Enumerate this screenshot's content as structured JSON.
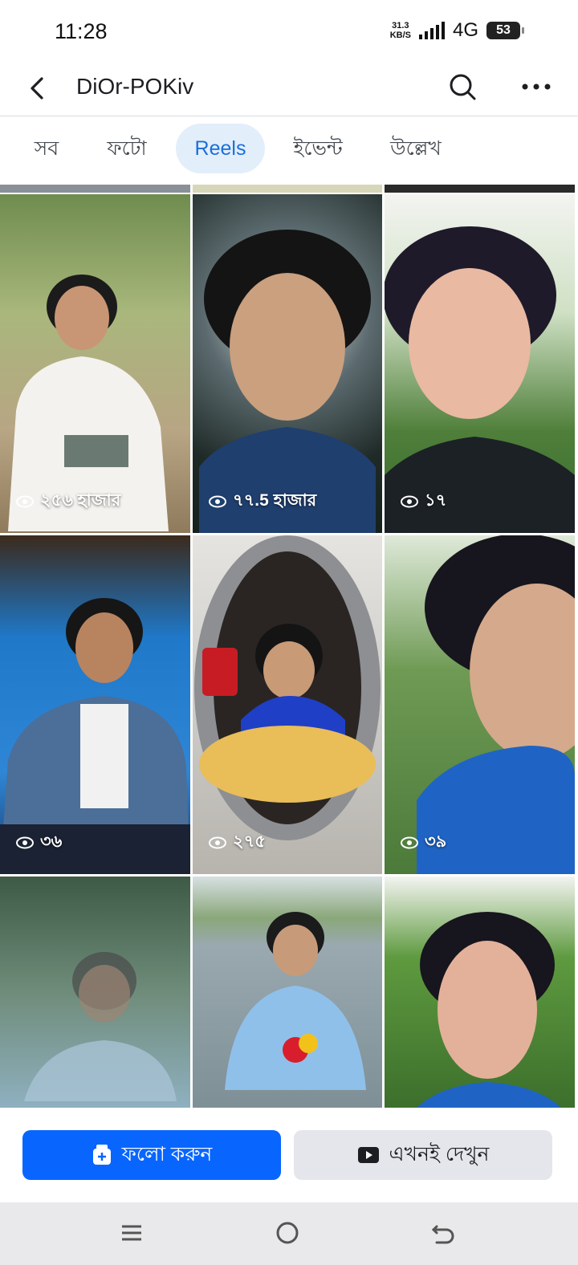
{
  "status": {
    "time": "11:28",
    "net_speed_value": "31.3",
    "net_speed_unit": "KB/S",
    "network": "4G",
    "battery": "53"
  },
  "header": {
    "title": "DiOr-POKiv",
    "back_icon": "back-arrow-icon",
    "search_icon": "search-icon",
    "more_icon": "more-horizontal-icon"
  },
  "tabs": [
    {
      "label": "সব",
      "active": false
    },
    {
      "label": "ফটো",
      "active": false
    },
    {
      "label": "Reels",
      "active": true
    },
    {
      "label": "ইভেন্ট",
      "active": false
    },
    {
      "label": "উল্লেখ",
      "active": false
    }
  ],
  "reels": [
    {
      "views": "২৫৬ হাজার"
    },
    {
      "views": "৭৭.5 হাজার"
    },
    {
      "views": "১৭"
    },
    {
      "views": "৩৬"
    },
    {
      "views": "২৭৫"
    },
    {
      "views": "৩৯"
    },
    {
      "views": ""
    },
    {
      "views": ""
    },
    {
      "views": ""
    }
  ],
  "actions": {
    "follow_label": "ফলো করুন",
    "watch_label": "এখনই দেখুন"
  },
  "colors": {
    "accent": "#0866ff",
    "active_tab_bg": "#e3eefb",
    "active_tab_text": "#1a6fd8"
  }
}
